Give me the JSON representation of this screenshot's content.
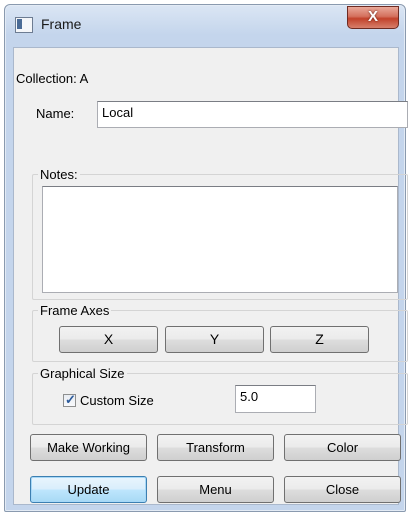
{
  "window": {
    "title": "Frame",
    "close_glyph": "X"
  },
  "collection": {
    "label": "Collection: A"
  },
  "name": {
    "label": "Name:",
    "value": "Local"
  },
  "notes": {
    "label": "Notes:",
    "value": ""
  },
  "frame_axes": {
    "label": "Frame Axes",
    "x_label": "X",
    "y_label": "Y",
    "z_label": "Z"
  },
  "graphical_size": {
    "label": "Graphical Size",
    "custom_size_label": "Custom Size",
    "custom_size_checked": true,
    "size_value": "5.0"
  },
  "buttons": {
    "make_working": "Make Working",
    "transform": "Transform",
    "color": "Color",
    "update": "Update",
    "menu": "Menu",
    "close": "Close"
  }
}
